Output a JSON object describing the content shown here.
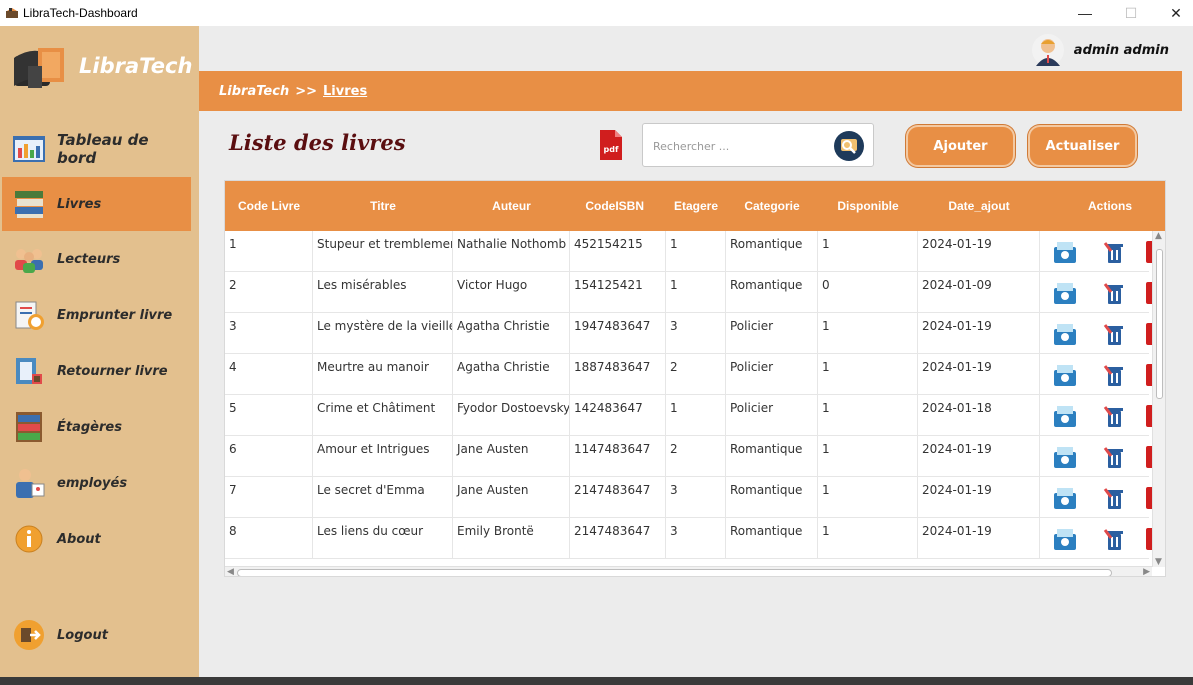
{
  "window": {
    "title": "LibraTech-Dashboard",
    "minimize": "—",
    "maximize": "☐",
    "close": "✕"
  },
  "brand": {
    "name": "LibraTech"
  },
  "user": {
    "name": "admin admin"
  },
  "nav": {
    "items": [
      {
        "label": "Tableau de bord"
      },
      {
        "label": "Livres"
      },
      {
        "label": "Lecteurs"
      },
      {
        "label": "Emprunter livre"
      },
      {
        "label": "Retourner livre"
      },
      {
        "label": "Étagères"
      },
      {
        "label": "employés"
      },
      {
        "label": "About"
      }
    ],
    "logout": "Logout"
  },
  "breadcrumb": {
    "root": "LibraTech",
    "sep": ">>",
    "current": "Livres"
  },
  "page": {
    "title": "Liste des livres",
    "pdf_label": "pdf"
  },
  "search": {
    "placeholder": "Rechercher ..."
  },
  "buttons": {
    "add": "Ajouter",
    "refresh": "Actualiser"
  },
  "table": {
    "columns": [
      "Code Livre",
      "Titre",
      "Auteur",
      "CodeISBN",
      "Etagere",
      "Categorie",
      "Disponible",
      "Date_ajout",
      "Actions"
    ],
    "rows": [
      [
        "1",
        "Stupeur et tremblement",
        "Nathalie Nothomb",
        "452154215",
        "1",
        "Romantique",
        "1",
        "2024-01-19"
      ],
      [
        "2",
        "Les misérables",
        "Victor Hugo",
        "154125421",
        "1",
        "Romantique",
        "0",
        "2024-01-09"
      ],
      [
        "3",
        "Le mystère de la vieille ...",
        "Agatha Christie",
        "1947483647",
        "3",
        "Policier",
        "1",
        "2024-01-19"
      ],
      [
        "4",
        "Meurtre au manoir",
        "Agatha Christie",
        "1887483647",
        "2",
        "Policier",
        "1",
        "2024-01-19"
      ],
      [
        "5",
        "Crime et Châtiment",
        "Fyodor Dostoevsky",
        "142483647",
        "1",
        "Policier",
        "1",
        "2024-01-18"
      ],
      [
        "6",
        "Amour et Intrigues",
        "Jane Austen",
        "1147483647",
        "2",
        "Romantique",
        "1",
        "2024-01-19"
      ],
      [
        "7",
        "Le secret d'Emma",
        "Jane Austen",
        "2147483647",
        "3",
        "Romantique",
        "1",
        "2024-01-19"
      ],
      [
        "8",
        "Les liens du cœur",
        "Emily Brontë",
        "2147483647",
        "3",
        "Romantique",
        "1",
        "2024-01-19"
      ]
    ]
  },
  "colors": {
    "sidebar": "#e3c08e",
    "accent": "#e88f45",
    "title": "#5a0e10"
  }
}
